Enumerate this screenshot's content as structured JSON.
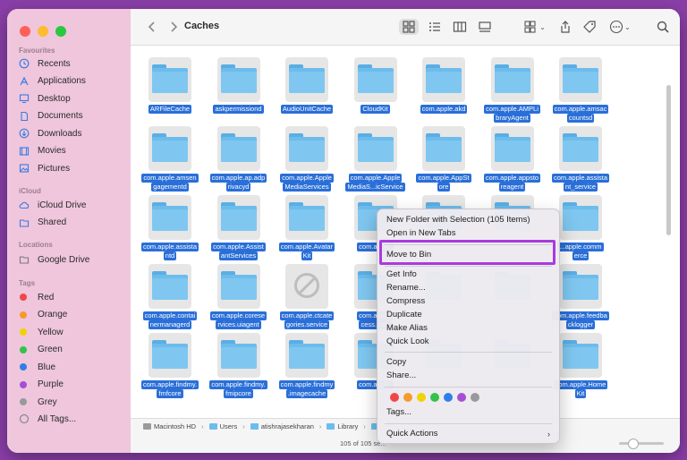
{
  "window": {
    "title": "Caches"
  },
  "sidebar": {
    "favorites_heading": "Favourites",
    "favorites": [
      {
        "label": "Recents",
        "icon": "clock-icon"
      },
      {
        "label": "Applications",
        "icon": "applications-icon"
      },
      {
        "label": "Desktop",
        "icon": "desktop-icon"
      },
      {
        "label": "Documents",
        "icon": "document-icon"
      },
      {
        "label": "Downloads",
        "icon": "download-icon"
      },
      {
        "label": "Movies",
        "icon": "film-icon"
      },
      {
        "label": "Pictures",
        "icon": "photo-icon"
      }
    ],
    "icloud_heading": "iCloud",
    "icloud": [
      {
        "label": "iCloud Drive",
        "icon": "cloud-icon"
      },
      {
        "label": "Shared",
        "icon": "shared-folder-icon"
      }
    ],
    "locations_heading": "Locations",
    "locations": [
      {
        "label": "Google Drive",
        "icon": "drive-icon"
      }
    ],
    "tags_heading": "Tags",
    "tags": [
      {
        "label": "Red",
        "color": "#f04747"
      },
      {
        "label": "Orange",
        "color": "#f59b2b"
      },
      {
        "label": "Yellow",
        "color": "#f2d200"
      },
      {
        "label": "Green",
        "color": "#33c24a"
      },
      {
        "label": "Blue",
        "color": "#2f7fe8"
      },
      {
        "label": "Purple",
        "color": "#a54fd6"
      },
      {
        "label": "Grey",
        "color": "#999999"
      }
    ],
    "all_tags": "All Tags..."
  },
  "toolbar": {
    "back_icon": "chevron-left-icon",
    "forward_icon": "chevron-right-icon",
    "view_icons": [
      "grid-view-icon",
      "list-view-icon",
      "column-view-icon",
      "gallery-view-icon"
    ],
    "group_icon": "group-icon",
    "share_icon": "share-icon",
    "tag_icon": "tag-icon",
    "more_icon": "more-icon",
    "search_icon": "search-icon"
  },
  "items": [
    [
      "ARFileCache"
    ],
    [
      "askpermissiond"
    ],
    [
      "AudioUnitCache"
    ],
    [
      "CloudKit"
    ],
    [
      "com.apple.akd"
    ],
    [
      "com.apple.AMPLi",
      "braryAgent"
    ],
    [
      "com.apple.amsac",
      "countsd"
    ],
    [
      "com.apple.amsen",
      "gagementd"
    ],
    [
      "com.apple.ap.adp",
      "rivacyd"
    ],
    [
      "com.apple.Apple",
      "MediaServices"
    ],
    [
      "com.apple.Apple",
      "MediaS...icService"
    ],
    [
      "com.apple.AppSt",
      "ore"
    ],
    [
      "com.apple.appsto",
      "reagent"
    ],
    [
      "com.apple.assista",
      "nt_service"
    ],
    [
      "com.apple.assista",
      "ntd"
    ],
    [
      "com.apple.Assist",
      "antServices"
    ],
    [
      "com.apple.Avatar",
      "Kit"
    ],
    [
      "com.apple.",
      ""
    ],
    [
      "",
      ""
    ],
    [
      "",
      ""
    ],
    [
      "...apple.comm",
      "erce"
    ],
    [
      "com.apple.contai",
      "nermanagerd"
    ],
    [
      "com.apple.corese",
      "rvices.uiagent"
    ],
    [
      "com.apple.ctcate",
      "gories.service"
    ],
    [
      "com.apple.",
      "cess.data"
    ],
    [
      "",
      ""
    ],
    [
      "",
      ""
    ],
    [
      "com.apple.feedba",
      "cklogger"
    ],
    [
      "com.apple.findmy.",
      "fmfcore"
    ],
    [
      "com.apple.findmy.",
      "fmipcore"
    ],
    [
      "com.apple.findmy",
      ".imagecache"
    ],
    [
      "com.apple.",
      ""
    ],
    [
      "",
      ""
    ],
    [
      "",
      ""
    ],
    [
      "com.apple.Home",
      "Kit"
    ]
  ],
  "pathbar": {
    "segments": [
      "Macintosh HD",
      "Users",
      "atishrajasekharan",
      "Library",
      ""
    ]
  },
  "status": {
    "text": "105 of 105 se..."
  },
  "context_menu": {
    "new_folder": "New Folder with Selection (105 Items)",
    "open_tabs": "Open in New Tabs",
    "move_to_bin": "Move to Bin",
    "get_info": "Get Info",
    "rename": "Rename...",
    "compress": "Compress",
    "duplicate": "Duplicate",
    "make_alias": "Make Alias",
    "quick_look": "Quick Look",
    "copy": "Copy",
    "share": "Share...",
    "tag_colors": [
      "#f04747",
      "#f59b2b",
      "#f2d200",
      "#33c24a",
      "#2f7fe8",
      "#a54fd6",
      "#999999"
    ],
    "tags": "Tags...",
    "quick_actions": "Quick Actions",
    "chevron": "›"
  }
}
